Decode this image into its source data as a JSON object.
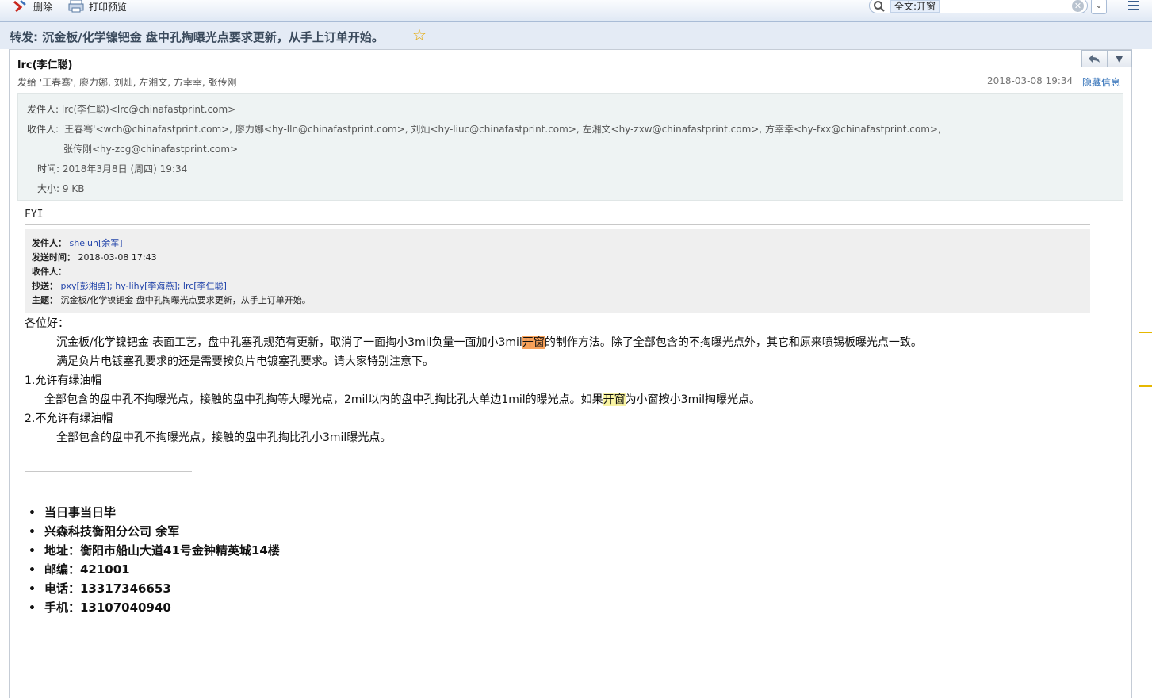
{
  "toolbar": {
    "delete_label": "删除",
    "print_label": "打印预览",
    "search_scope": "全文:开窗"
  },
  "message": {
    "subject": "转发: 沉金板/化学镍钯金 盘中孔掏曝光点要求更新，从手上订单开始。",
    "sender_name": "lrc(李仁聪)",
    "recipients_summary": "发给 '王春骞', 廖力娜, 刘灿, 左湘文, 方幸幸, 张传刚",
    "date": "2018-03-08 19:34",
    "hide_info_label": "隐藏信息",
    "details": {
      "from_label": "发件人:",
      "from_value": "lrc(李仁聪)<lrc@chinafastprint.com>",
      "to_label": "收件人:",
      "to_value_line1": "'王春骞'<wch@chinafastprint.com>, 廖力娜<hy-lln@chinafastprint.com>, 刘灿<hy-liuc@chinafastprint.com>, 左湘文<hy-zxw@chinafastprint.com>, 方幸幸<hy-fxx@chinafastprint.com>,",
      "to_value_line2": "张传刚<hy-zcg@chinafastprint.com>",
      "time_label": "时间:",
      "time_value": "2018年3月8日 (周四) 19:34",
      "size_label": "大小:",
      "size_value": "9 KB"
    }
  },
  "body": {
    "fyi": "FYI",
    "forward": {
      "from_label": "发件人：",
      "from_value": "shejun[余军]",
      "sent_label": "发送时间：",
      "sent_value": "2018-03-08 17:43",
      "to_label": "收件人：",
      "cc_label": "抄送：",
      "cc_value": "pxy[彭湘勇]; hy-lihy[李海燕]; lrc[李仁聪]",
      "subject_label": "主题：",
      "subject_value": "沉金板/化学镍钯金 盘中孔掏曝光点要求更新，从手上订单开始。"
    },
    "greeting": "各位好：",
    "p1_a": "沉金板/化学镍钯金 表面工艺，盘中孔塞孔规范有更新，取消了一面掏小3mil负量一面加小3mil",
    "p1_hl": "开窗",
    "p1_b": "的制作方法。除了全部包含的不掏曝光点外，其它和原来喷锡板曝光点一致。",
    "p2": "满足负片电镀塞孔要求的还是需要按负片电镀塞孔要求。请大家特别注意下。",
    "h1": "1.允许有绿油帽",
    "p3_a": "全部包含的盘中孔不掏曝光点，接触的盘中孔掏等大曝光点，2mil以内的盘中孔掏比孔大单边1mil的曝光点。如果",
    "p3_hl": "开窗",
    "p3_b": "为小窗按小3mil掏曝光点。",
    "h2": "2.不允许有绿油帽",
    "p4": "全部包含的盘中孔不掏曝光点，接触的盘中孔掏比孔小3mil曝光点。"
  },
  "signature": [
    "当日事当日毕",
    "兴森科技衡阳分公司 余军",
    "地址：衡阳市船山大道41号金钟精英城14楼",
    "邮编：421001",
    "电话：13317346653",
    "手机：13107040940"
  ]
}
